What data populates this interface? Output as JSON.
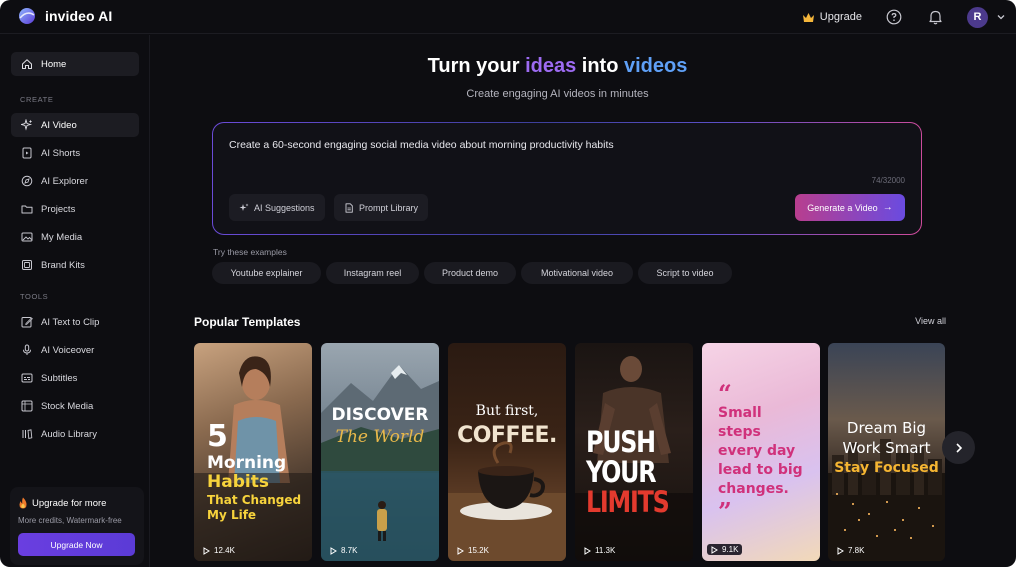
{
  "app": {
    "name": "invideo AI"
  },
  "header": {
    "upgrade_label": "Upgrade",
    "avatar_initial": "R"
  },
  "sidebar": {
    "home": "Home",
    "create_label": "CREATE",
    "create_items": [
      "AI Video",
      "AI Shorts",
      "AI Explorer",
      "Projects",
      "My Media",
      "Brand Kits"
    ],
    "tools_label": "TOOLS",
    "tools_items": [
      "AI Text to Clip",
      "AI Voiceover",
      "Subtitles",
      "Stock Media",
      "Audio Library"
    ],
    "upgrade_card": {
      "title": "Upgrade for more",
      "subtitle": "More credits, Watermark-free",
      "button": "Upgrade Now"
    }
  },
  "hero": {
    "title_part1": "Turn your ",
    "title_ideas": "ideas",
    "title_part2": " into ",
    "title_videos": "videos",
    "subtitle": "Create engaging AI videos in minutes"
  },
  "prompt": {
    "text": "Create a 60-second engaging social media video about morning productivity habits",
    "char_count": "74/32000",
    "ai_suggestions": "AI Suggestions",
    "prompt_library": "Prompt Library",
    "generate": "Generate a Video"
  },
  "examples": {
    "label": "Try these examples",
    "items": [
      "Youtube explainer",
      "Instagram reel",
      "Product demo",
      "Motivational video",
      "Script to video"
    ]
  },
  "templates": {
    "title": "Popular Templates",
    "view_all": "View all",
    "cards": [
      {
        "l1": "5",
        "l2": "Morning",
        "l3": "Habits",
        "l4": "That Changed",
        "l5": "My Life",
        "views": "12.4K"
      },
      {
        "l1": "DISCOVER",
        "l2": "The World",
        "views": "8.7K"
      },
      {
        "l1": "But first,",
        "l2": "COFFEE.",
        "views": "15.2K"
      },
      {
        "l1": "PUSH",
        "l2": "YOUR",
        "l3": "LIMITS",
        "views": "11.3K"
      },
      {
        "l1": "Small",
        "l2": "steps",
        "l3": "every day",
        "l4": "lead to big",
        "l5": "changes.",
        "views": "9.1K"
      },
      {
        "l1": "Dream Big",
        "l2": "Work Smart",
        "l3": "Stay Focused",
        "views": "7.8K"
      }
    ]
  },
  "colors": {
    "accent_purple": "#9d6bf2",
    "accent_blue": "#5fa0f7",
    "upgrade_gradient_start": "#6a3ee0",
    "generate_gradient_start": "#b83e8e"
  }
}
